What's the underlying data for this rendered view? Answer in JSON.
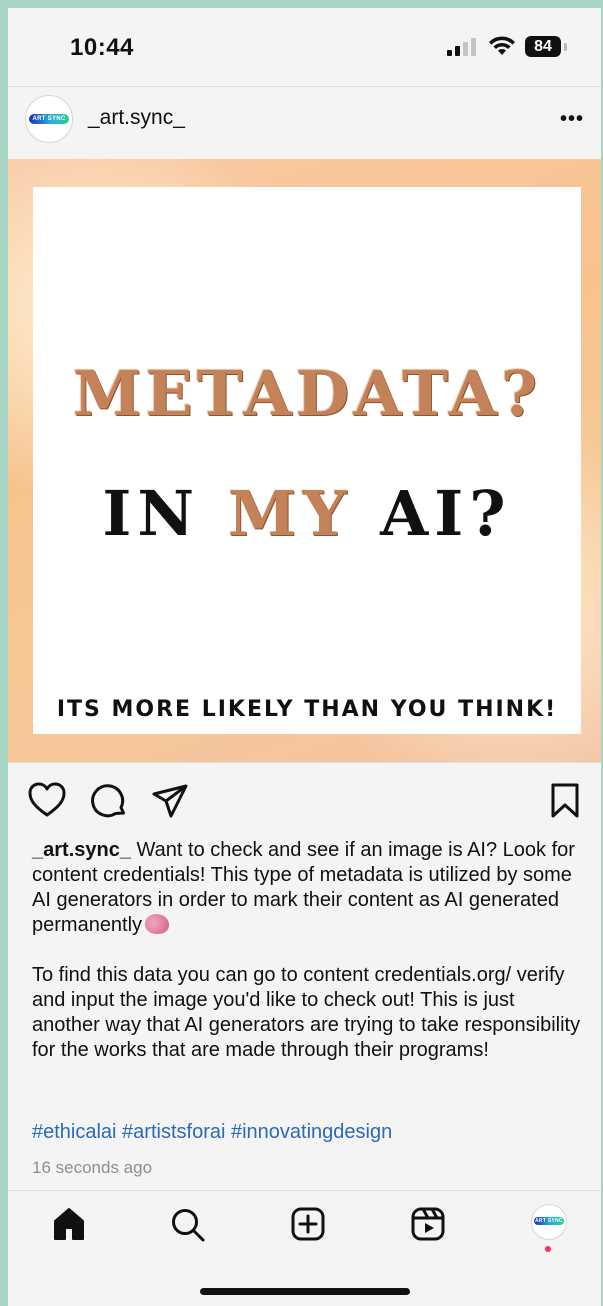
{
  "status_bar": {
    "time": "10:44",
    "battery": "84",
    "icons": [
      "cellular-signal-icon",
      "wifi-icon",
      "battery-icon"
    ]
  },
  "post_header": {
    "username": "_art.sync_",
    "avatar_logo_text": "ART SYNC",
    "more_label": "•••"
  },
  "post_image": {
    "headline": "METADATA?",
    "subheadline_pre": "IN ",
    "subheadline_highlight": "MY",
    "subheadline_post": " AI?",
    "tagline": "ITS MORE LIKELY THAN YOU THINK!",
    "colors": {
      "bronze": "#c48258",
      "frame": "#f7c38d"
    }
  },
  "actions": {
    "icons": [
      "heart-icon",
      "comment-icon",
      "share-icon",
      "bookmark-icon"
    ]
  },
  "caption": {
    "username": "_art.sync_",
    "paragraph1": " Want to check and see if an image is AI? Look for content credentials! This type of metadata is utilized by some AI generators in order to mark their content as AI generated permanently",
    "paragraph2": "To find this data you can go to content credentials.org/ verify and input the image you'd like to check out! This is just another way that AI generators are trying to take responsibility for the works that are made through their programs!",
    "hashtags": "#ethicalai #artistsforai #innovatingdesign",
    "time_ago": "16 seconds ago"
  },
  "bottom_nav": {
    "items": [
      "home-icon",
      "search-icon",
      "create-icon",
      "reels-icon",
      "profile-avatar"
    ]
  }
}
